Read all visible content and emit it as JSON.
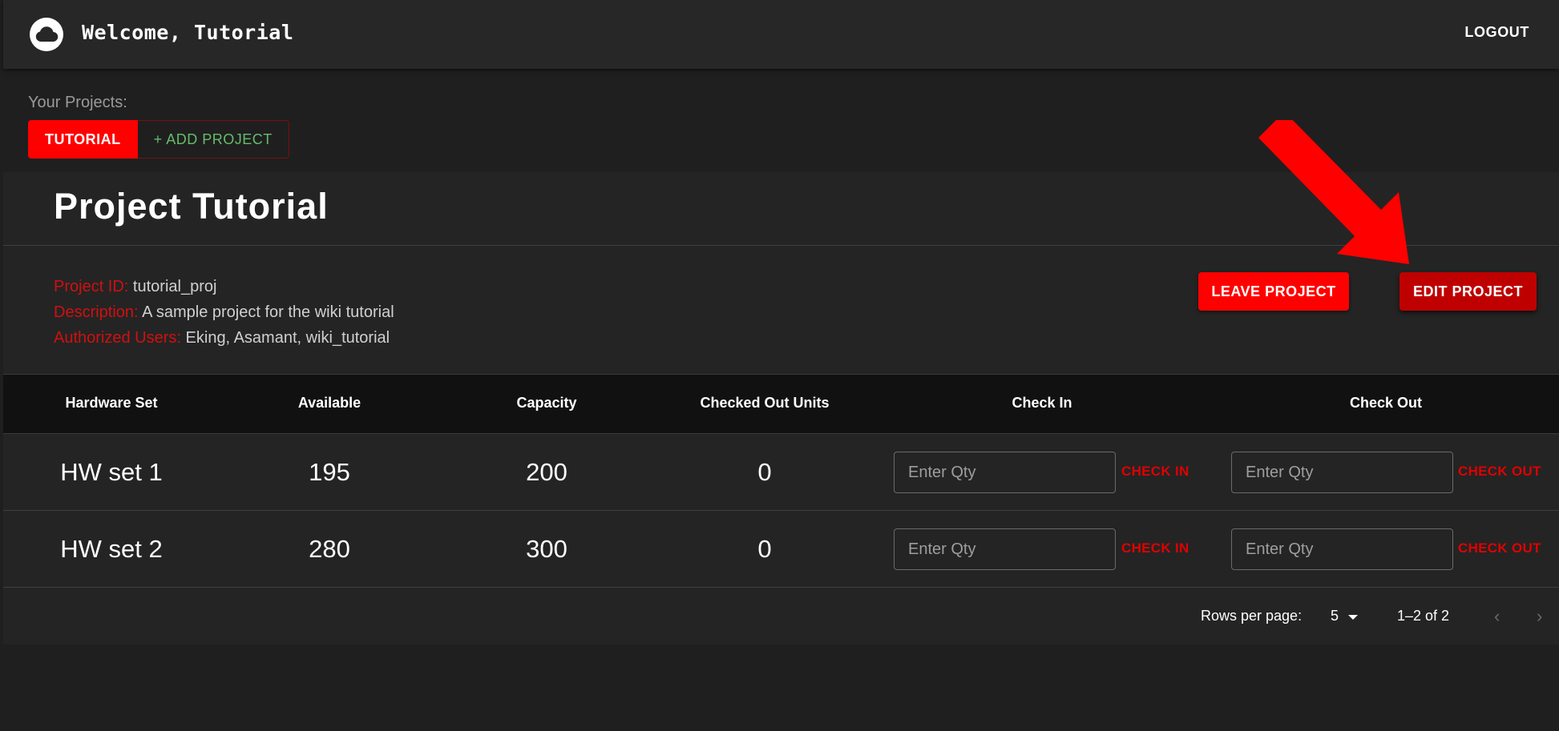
{
  "header": {
    "title": "Welcome, Tutorial",
    "logout_label": "LOGOUT",
    "logo_icon": "cloud-icon"
  },
  "projects": {
    "heading": "Your Projects:",
    "tabs": [
      {
        "label": "TUTORIAL",
        "selected": true
      },
      {
        "label": "+ ADD PROJECT",
        "selected": false
      }
    ]
  },
  "project": {
    "title": "Project Tutorial",
    "id_label": "Project ID:",
    "id_value": "tutorial_proj",
    "desc_label": "Description:",
    "desc_value": "A sample project for the wiki tutorial",
    "users_label": "Authorized Users:",
    "users_value": "Eking, Asamant, wiki_tutorial",
    "leave_label": "LEAVE PROJECT",
    "edit_label": "EDIT PROJECT"
  },
  "table": {
    "headers": [
      "Hardware Set",
      "Available",
      "Capacity",
      "Checked Out Units",
      "Check In",
      "Check Out"
    ],
    "rows": [
      {
        "name": "HW set 1",
        "available": "195",
        "capacity": "200",
        "checked_out": "0"
      },
      {
        "name": "HW set 2",
        "available": "280",
        "capacity": "300",
        "checked_out": "0"
      }
    ],
    "qty_placeholder": "Enter Qty",
    "check_in_label": "CHECK IN",
    "check_out_label": "CHECK OUT"
  },
  "pagination": {
    "rows_per_page_label": "Rows per page:",
    "rows_per_page_value": "5",
    "range_text": "1–2 of 2",
    "prev_icon": "chevron-left-icon",
    "next_icon": "chevron-right-icon"
  },
  "colors": {
    "accent_red": "#ff0000",
    "edit_red": "#bf0000",
    "label_red": "#d01010",
    "add_green": "#66bb6a",
    "background": "#1f1f1f"
  }
}
